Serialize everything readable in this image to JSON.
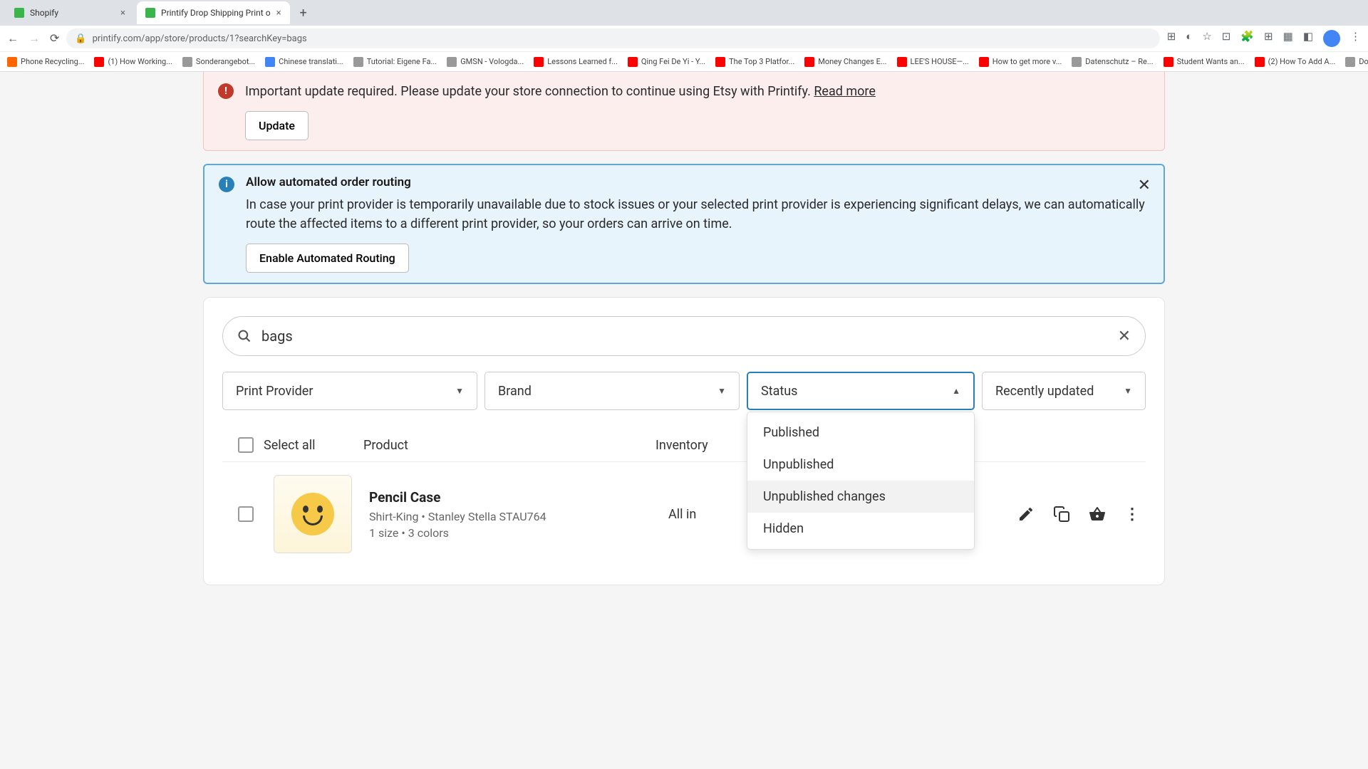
{
  "browser": {
    "tabs": [
      {
        "title": "Shopify",
        "active": false
      },
      {
        "title": "Printify Drop Shipping Print o",
        "active": true
      }
    ],
    "url": "printify.com/app/store/products/1?searchKey=bags",
    "bookmarks": [
      "Phone Recycling...",
      "(1) How Working...",
      "Sonderangebot...",
      "Chinese translati...",
      "Tutorial: Eigene Fa...",
      "GMSN - Vologda...",
      "Lessons Learned f...",
      "Qing Fei De Yi - Y...",
      "The Top 3 Platfor...",
      "Money Changes E...",
      "LEE'S HOUSE—...",
      "How to get more v...",
      "Datenschutz – Re...",
      "Student Wants an...",
      "(2) How To Add A...",
      "Download - Cooki..."
    ]
  },
  "alerts": {
    "warning": {
      "text": "Important update required. Please update your store connection to continue using Etsy with Printify.",
      "link": "Read more",
      "button": "Update"
    },
    "info": {
      "title": "Allow automated order routing",
      "text": "In case your print provider is temporarily unavailable due to stock issues or your selected print provider is experiencing significant delays, we can automatically route the affected items to a different print provider, so your orders can arrive on time.",
      "button": "Enable Automated Routing"
    }
  },
  "search": {
    "value": "bags"
  },
  "filters": {
    "print_provider": "Print Provider",
    "brand": "Brand",
    "status": "Status",
    "sort": "Recently updated",
    "status_options": [
      "Published",
      "Unpublished",
      "Unpublished changes",
      "Hidden"
    ]
  },
  "table": {
    "select_all": "Select all",
    "col_product": "Product",
    "col_inventory": "Inventory"
  },
  "products": [
    {
      "name": "Pencil Case",
      "provider": "Shirt-King • Stanley Stella STAU764",
      "variants": "1 size • 3 colors",
      "inventory": "All in"
    }
  ]
}
